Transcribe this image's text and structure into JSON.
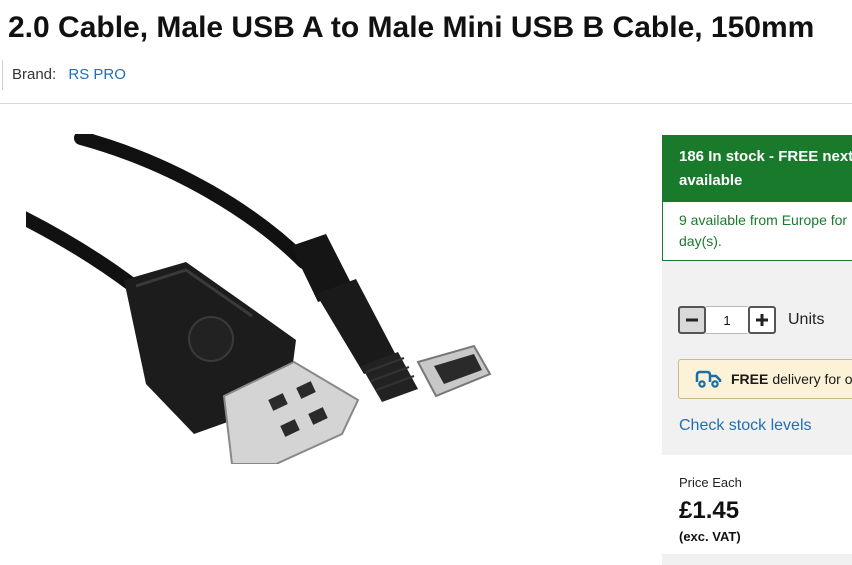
{
  "product": {
    "title": "2.0 Cable, Male USB A to Male Mini USB B Cable, 150mm",
    "brand_label": "Brand:",
    "brand_name": "RS PRO"
  },
  "stock": {
    "header_line1": "186 In stock - FREE next",
    "header_line2": "available",
    "sub_line1": "9 available from Europe for",
    "sub_line2": "day(s)."
  },
  "quantity": {
    "value": "1",
    "units_label": "Units",
    "minus_icon": "minus-icon",
    "plus_icon": "plus-icon"
  },
  "delivery": {
    "icon": "delivery-truck-icon",
    "bold_text": "FREE",
    "text": "delivery for or"
  },
  "check_stock_label": "Check stock levels",
  "price": {
    "label": "Price Each",
    "value": "£1.45",
    "vat_note": "(exc. VAT)"
  },
  "colors": {
    "stock_green": "#1a7a2c",
    "link_blue": "#1f6fb5",
    "delivery_bg": "#fbf2d8",
    "buybox_grey": "#f1f1f1"
  }
}
